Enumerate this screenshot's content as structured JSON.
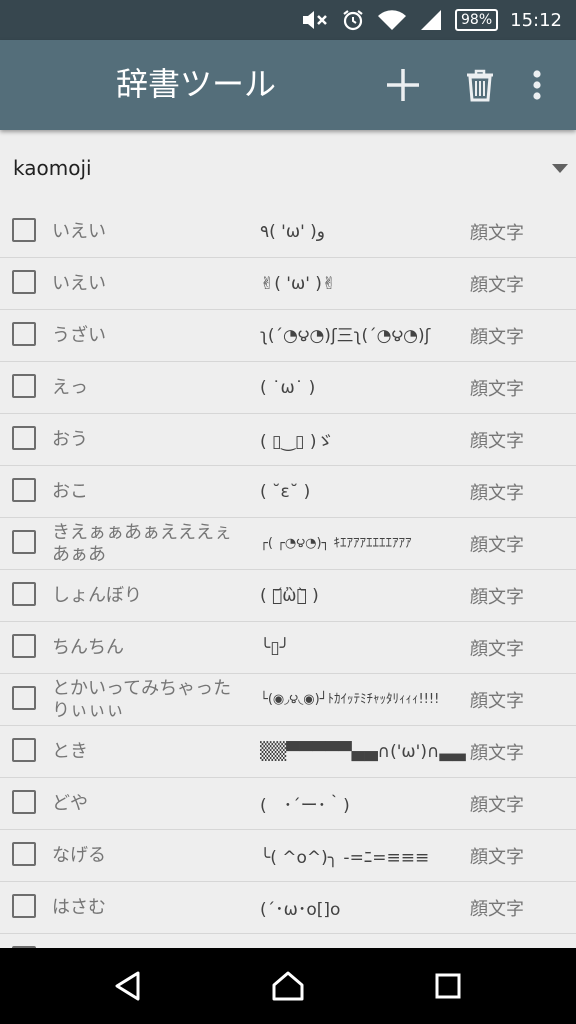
{
  "status_bar": {
    "battery": "98%",
    "time": "15:12"
  },
  "toolbar": {
    "title": "辞書ツール"
  },
  "filter": {
    "selected": "kaomoji"
  },
  "entries": [
    {
      "reading": "いえい",
      "word": "٩( 'ω' )و",
      "pos": "顔文字"
    },
    {
      "reading": "いえい",
      "word": "✌( 'ω' )✌",
      "pos": "顔文字"
    },
    {
      "reading": "うざい",
      "word": "ʅ(´◔౪◔)ʃ三ʅ(´◔౪◔)ʃ",
      "pos": "顔文字"
    },
    {
      "reading": "えっ",
      "word": "( ˙ω˙ )",
      "pos": "顔文字"
    },
    {
      "reading": "おう",
      "word": "( ▯‿▯ )ゞ",
      "pos": "顔文字"
    },
    {
      "reading": "おこ",
      "word": "( ˘ε˘ )",
      "pos": "顔文字"
    },
    {
      "reading": "きえぁぁあぁえええぇあぁあ",
      "word": "┌( ┌◔౪◔)┐ ｷｴｱｱｱｴｴｴｴｱｱｱ",
      "pos": "顔文字"
    },
    {
      "reading": "しょんぼり",
      "word": "( ･᷄ὢ･᷅ )",
      "pos": "顔文字"
    },
    {
      "reading": "ちんちん",
      "word": "╰▯╯",
      "pos": "顔文字"
    },
    {
      "reading": "とかいってみちゃったりぃぃぃ",
      "word": "└(◉◞౪◟◉)┘ﾄｶｲｯﾃﾐﾁｬｯﾀﾘｨｨｨ!!!!",
      "pos": "顔文字"
    },
    {
      "reading": "とき",
      "word": "▒▒▀▀▀▀▀▄▄∩('ω')∩▃▃",
      "pos": "顔文字"
    },
    {
      "reading": "どや",
      "word": "(　･´ー･｀)",
      "pos": "顔文字"
    },
    {
      "reading": "なげる",
      "word": "╰( ^o^)╮ -=ﾆ=≡≡≡",
      "pos": "顔文字"
    },
    {
      "reading": "はさむ",
      "word": "(´･ω･o[]o",
      "pos": "顔文字"
    },
    {
      "reading": "",
      "word": "",
      "pos": ""
    }
  ]
}
